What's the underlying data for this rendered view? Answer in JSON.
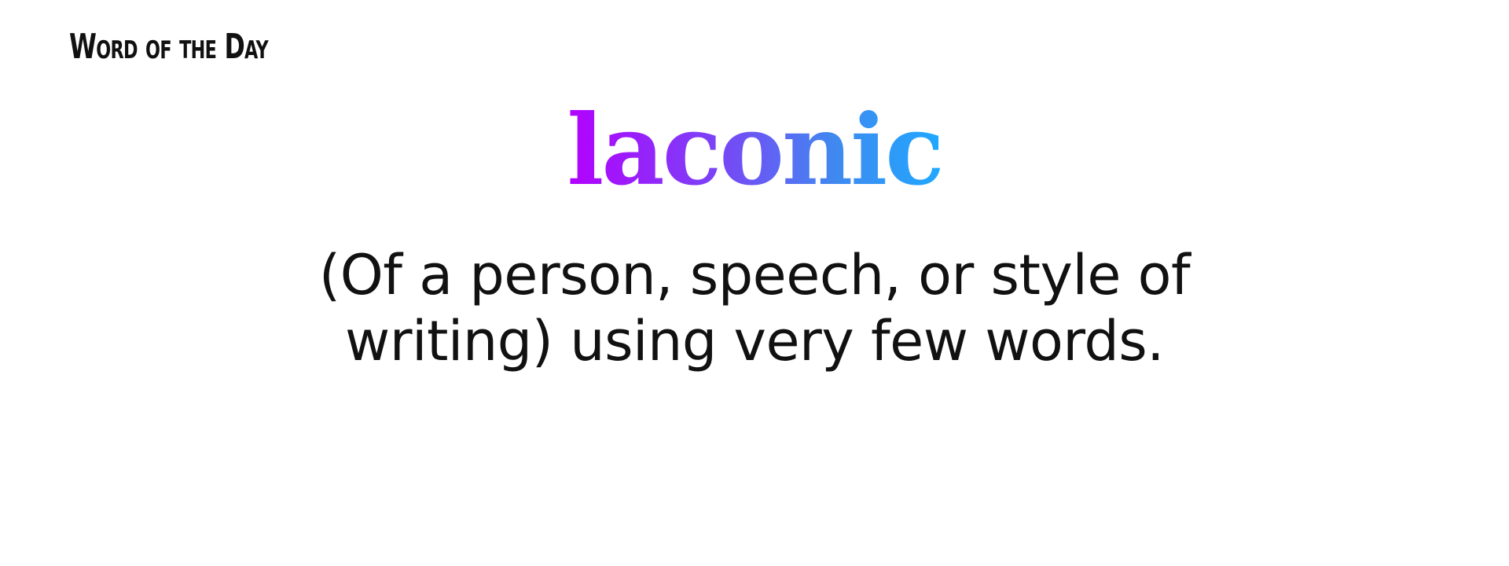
{
  "header": {
    "label": "Word of the Day"
  },
  "word": {
    "text": "laconic",
    "gradient_colors": [
      "#b300ff",
      "#7a44f6",
      "#3f8af0",
      "#1fa8ff"
    ]
  },
  "definition": {
    "text": "(Of a person, speech, or style of writing) using very few words."
  }
}
